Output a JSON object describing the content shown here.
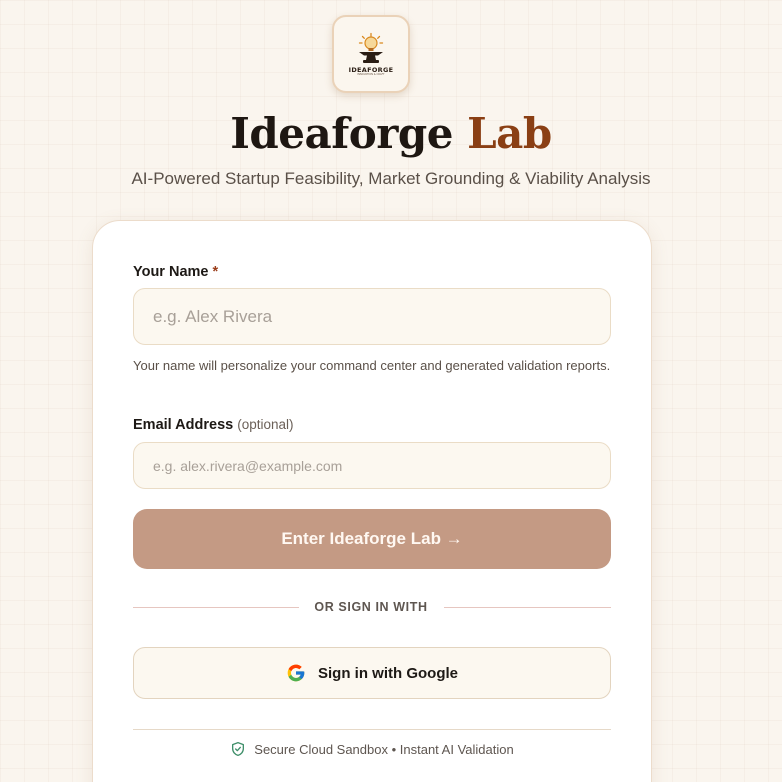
{
  "brand": {
    "logo_word": "IDEAFORGE",
    "logo_tagline": "INNOVATION & CRAFT",
    "title_main": "Ideaforge",
    "title_accent": "Lab",
    "subtitle": "AI-Powered Startup Feasibility, Market Grounding & Viability Analysis"
  },
  "form": {
    "name_label": "Your Name",
    "name_required_mark": "*",
    "name_placeholder": "e.g. Alex Rivera",
    "name_value": "",
    "name_helper": "Your name will personalize your command center and generated validation reports.",
    "email_label": "Email Address",
    "email_optional": "(optional)",
    "email_placeholder": "e.g. alex.rivera@example.com",
    "email_value": "",
    "submit_label": "Enter Ideaforge Lab →"
  },
  "divider": {
    "text": "OR SIGN IN WITH"
  },
  "google": {
    "label": "Sign in with Google",
    "icon": "google-icon"
  },
  "footer": {
    "text": "Secure Cloud Sandbox • Instant AI Validation",
    "icon": "shield-check-icon"
  },
  "colors": {
    "accent": "#8a3f14",
    "button": "#c49a84",
    "background": "#faf5ee",
    "shield": "#3f8f6a"
  }
}
